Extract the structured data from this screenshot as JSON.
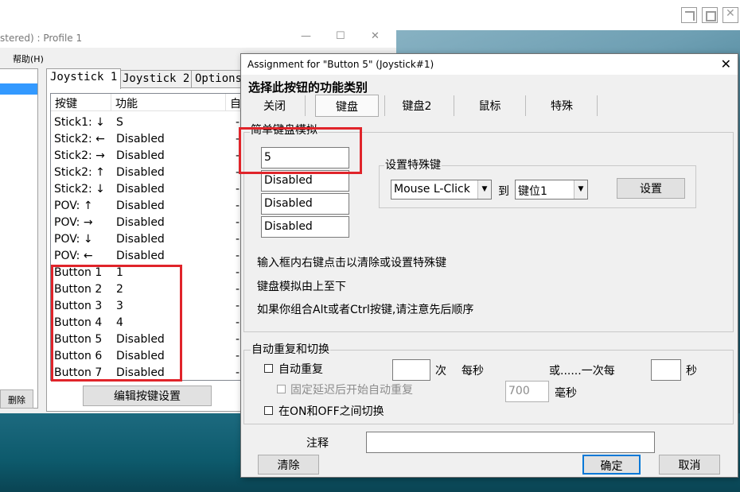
{
  "page_icons": [
    "external-link-icon",
    "maximize-icon",
    "close-icon"
  ],
  "bgwin": {
    "title": "stered) : Profile 1",
    "menu_help": "帮助(H)",
    "left_button": "删除",
    "tabs": [
      "Joystick 1",
      "Joystick 2",
      "Options"
    ],
    "columns": [
      "按键",
      "功能",
      "自"
    ],
    "rows": [
      {
        "key": "Stick1: ↓",
        "func": "S"
      },
      {
        "key": "Stick2: ←",
        "func": "Disabled"
      },
      {
        "key": "Stick2: →",
        "func": "Disabled"
      },
      {
        "key": "Stick2: ↑",
        "func": "Disabled"
      },
      {
        "key": "Stick2: ↓",
        "func": "Disabled"
      },
      {
        "key": "POV: ↑",
        "func": "Disabled"
      },
      {
        "key": "POV: →",
        "func": "Disabled"
      },
      {
        "key": "POV: ↓",
        "func": "Disabled"
      },
      {
        "key": "POV: ←",
        "func": "Disabled"
      },
      {
        "key": "Button 1",
        "func": "1"
      },
      {
        "key": "Button 2",
        "func": "2"
      },
      {
        "key": "Button 3",
        "func": "3"
      },
      {
        "key": "Button 4",
        "func": "4"
      },
      {
        "key": "Button 5",
        "func": "Disabled"
      },
      {
        "key": "Button 6",
        "func": "Disabled"
      },
      {
        "key": "Button 7",
        "func": "Disabled"
      }
    ],
    "edit_button": "编辑按键设置"
  },
  "dialog": {
    "title": "Assignment for \"Button 5\" (Joystick#1)",
    "heading": "选择此按钮的功能类别",
    "tabs": [
      "关闭",
      "键盘",
      "键盘2",
      "鼠标",
      "特殊"
    ],
    "active_tab": "键盘",
    "simple_group_label": "简单键盘模拟",
    "keys": [
      "5",
      "Disabled",
      "Disabled",
      "Disabled"
    ],
    "special_group_label": "设置特殊键",
    "special_combo": "Mouse L-Click",
    "to_label": "到",
    "slot_combo": "键位1",
    "set_button": "设置",
    "help_lines": [
      "输入框内右键点击以清除或设置特殊键",
      "键盘模拟由上至下",
      "如果你组合Alt或者Ctrl按键,请注意先后顺序"
    ],
    "repeat": {
      "group_label": "自动重复和切换",
      "auto_repeat": "自动重复",
      "times_value": "",
      "times_unit": "次",
      "per_second": "每秒",
      "or_once_every": "或......一次每",
      "seconds_value": "",
      "seconds_unit": "秒",
      "delay_option": "固定延迟后开始自动重复",
      "delay_value": "700",
      "ms_unit": "毫秒",
      "toggle_option": "在ON和OFF之间切换"
    },
    "comment_label": "注释",
    "comment_value": "",
    "clear_button": "清除",
    "ok_button": "确定",
    "cancel_button": "取消"
  },
  "colors": {
    "highlight": "#e0242a",
    "selection": "#3399ff"
  }
}
